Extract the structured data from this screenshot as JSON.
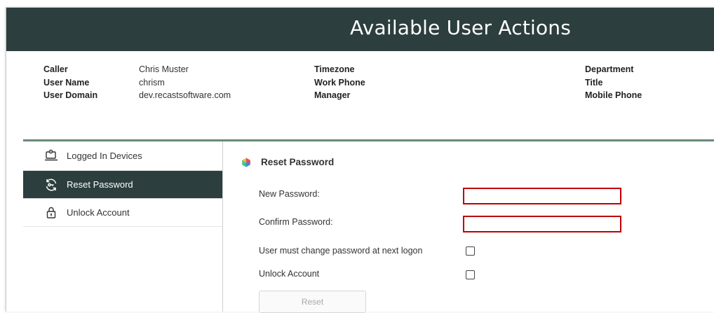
{
  "header": {
    "title": "Available User Actions"
  },
  "user_info": {
    "col1": [
      {
        "label": "Caller",
        "value": "Chris Muster"
      },
      {
        "label": "User Name",
        "value": "chrism"
      },
      {
        "label": "User Domain",
        "value": "dev.recastsoftware.com"
      }
    ],
    "col2": [
      {
        "label": "Timezone",
        "value": ""
      },
      {
        "label": "Work Phone",
        "value": ""
      },
      {
        "label": "Manager",
        "value": ""
      }
    ],
    "col3": [
      {
        "label": "Department",
        "value": ""
      },
      {
        "label": "Title",
        "value": ""
      },
      {
        "label": "Mobile Phone",
        "value": ""
      }
    ]
  },
  "sidebar": {
    "items": [
      {
        "label": "Logged In Devices",
        "icon": "laptop-gear-icon",
        "active": false
      },
      {
        "label": "Reset Password",
        "icon": "refresh-key-icon",
        "active": true
      },
      {
        "label": "Unlock Account",
        "icon": "padlock-icon",
        "active": false
      }
    ]
  },
  "form": {
    "title": "Reset Password",
    "title_icon": "gem-icon",
    "new_password_label": "New Password:",
    "new_password_value": "",
    "confirm_password_label": "Confirm Password:",
    "confirm_password_value": "",
    "must_change_label": "User must change password at next logon",
    "must_change_checked": false,
    "unlock_label": "Unlock Account",
    "unlock_checked": false,
    "reset_button_label": "Reset"
  },
  "colors": {
    "header_bg": "#2c3e3d",
    "active_nav_bg": "#2c3e3d",
    "divider": "#6a8878",
    "error_border": "#c00000"
  }
}
